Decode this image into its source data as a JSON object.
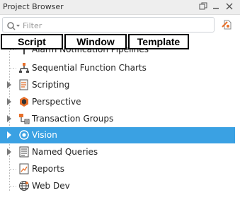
{
  "window": {
    "title": "Project Browser"
  },
  "filter": {
    "placeholder": "Filter"
  },
  "mode_tabs": [
    "Script",
    "Window",
    "Template"
  ],
  "tree": [
    {
      "label": "Alarm Notification Pipelines",
      "icon": "alarm-pipeline-icon",
      "expandable": false,
      "selected": false
    },
    {
      "label": "Sequential Function Charts",
      "icon": "sfc-icon",
      "expandable": false,
      "selected": false
    },
    {
      "label": "Scripting",
      "icon": "scripting-icon",
      "expandable": true,
      "selected": false
    },
    {
      "label": "Perspective",
      "icon": "perspective-icon",
      "expandable": true,
      "selected": false
    },
    {
      "label": "Transaction Groups",
      "icon": "transaction-groups-icon",
      "expandable": true,
      "selected": false
    },
    {
      "label": "Vision",
      "icon": "vision-icon",
      "expandable": true,
      "selected": true
    },
    {
      "label": "Named Queries",
      "icon": "named-queries-icon",
      "expandable": true,
      "selected": false
    },
    {
      "label": "Reports",
      "icon": "reports-icon",
      "expandable": false,
      "selected": false
    },
    {
      "label": "Web Dev",
      "icon": "web-dev-icon",
      "expandable": false,
      "selected": false
    }
  ],
  "colors": {
    "selection": "#3aa1e3"
  }
}
